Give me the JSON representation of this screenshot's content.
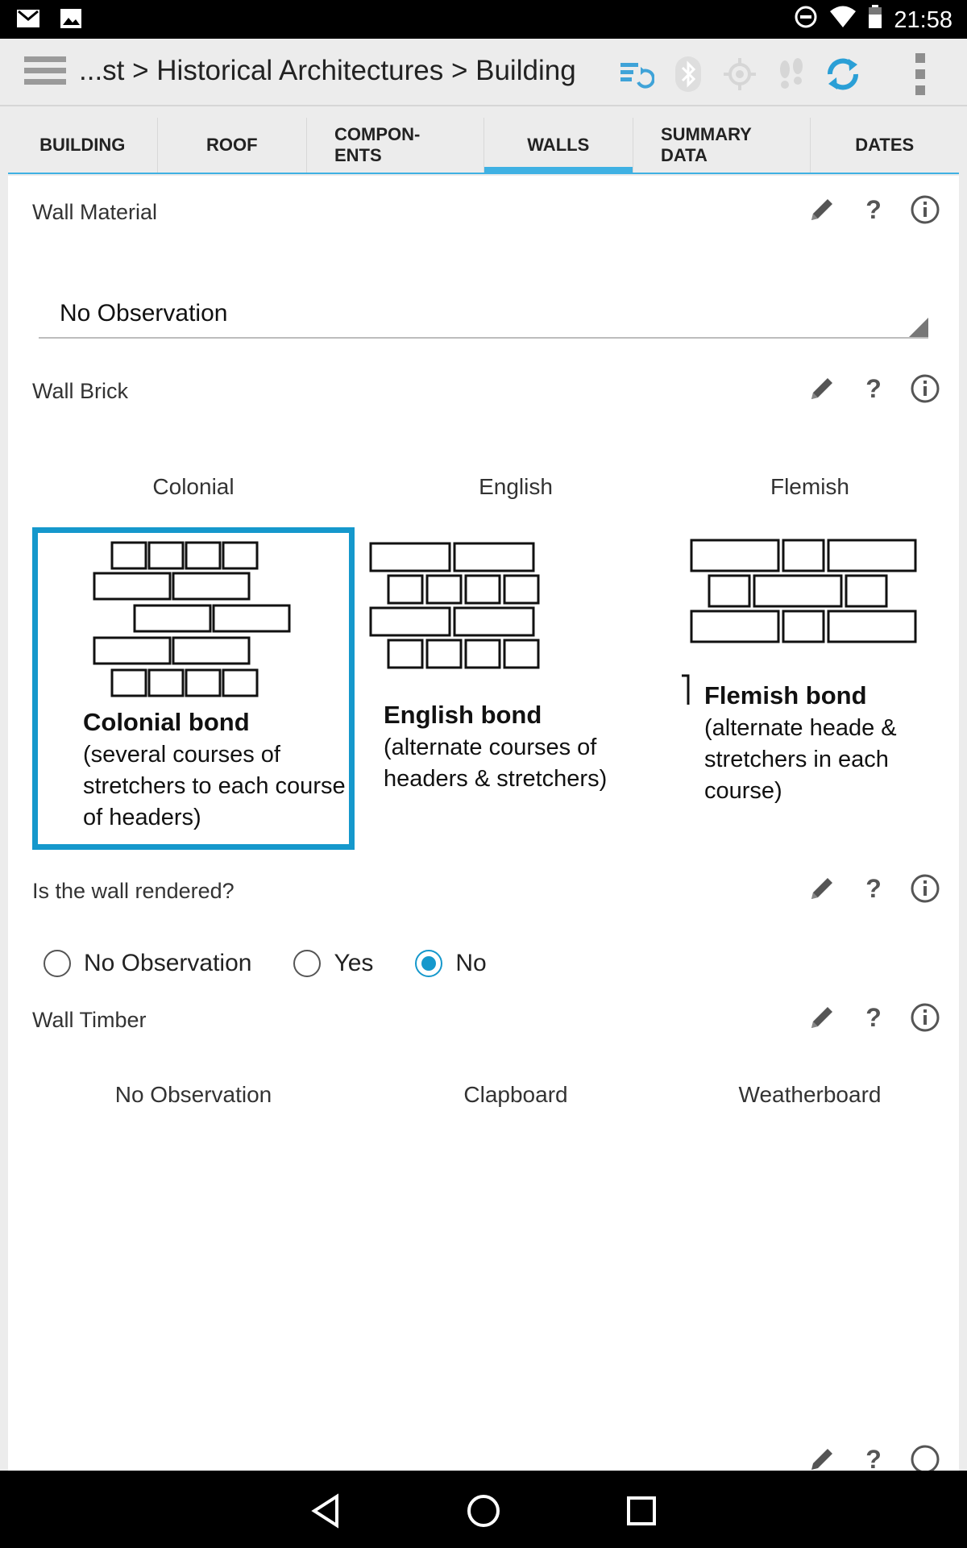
{
  "status_bar": {
    "time": "21:58"
  },
  "action_bar": {
    "title": "...st > Historical Architectures > Building"
  },
  "tabs": [
    {
      "label": "BUILDING"
    },
    {
      "label": "ROOF"
    },
    {
      "label": "COMPON-\nENTS"
    },
    {
      "label": "WALLS",
      "active": true
    },
    {
      "label": "SUMMARY\nDATA"
    },
    {
      "label": "DATES"
    }
  ],
  "wall_material": {
    "label": "Wall Material",
    "selected_value": "No Observation"
  },
  "wall_brick": {
    "label": "Wall Brick",
    "options": [
      {
        "caption": "Colonial",
        "bond_title": "Colonial bond",
        "bond_desc": "(several courses of stretchers to each course of headers)",
        "selected": true
      },
      {
        "caption": "English",
        "bond_title": "English bond",
        "bond_desc": "(alternate courses of headers & stretchers)"
      },
      {
        "caption": "Flemish",
        "bond_title": "Flemish bond",
        "bond_desc": "(alternate heade & stretchers in each course)"
      }
    ]
  },
  "wall_rendered": {
    "label": "Is the wall rendered?",
    "options": [
      "No Observation",
      "Yes",
      "No"
    ],
    "selected": "No"
  },
  "wall_timber": {
    "label": "Wall Timber",
    "options": [
      "No Observation",
      "Clapboard",
      "Weatherboard"
    ]
  },
  "colors": {
    "accent": "#1598cc",
    "tab_accent": "#3fb1e3",
    "sync_blue": "#2a9fd6"
  },
  "icons": {
    "status": [
      "gmail-icon",
      "image-icon",
      "do-not-disturb-icon",
      "wifi-icon",
      "battery-icon"
    ],
    "action_bar": [
      "menu-icon",
      "sync-settings-icon",
      "bluetooth-icon",
      "gps-icon",
      "footsteps-icon",
      "sync-icon",
      "overflow-menu-icon"
    ],
    "field": [
      "pencil-icon",
      "help-icon",
      "info-icon"
    ],
    "nav": [
      "back-icon",
      "home-icon",
      "recents-icon"
    ]
  }
}
